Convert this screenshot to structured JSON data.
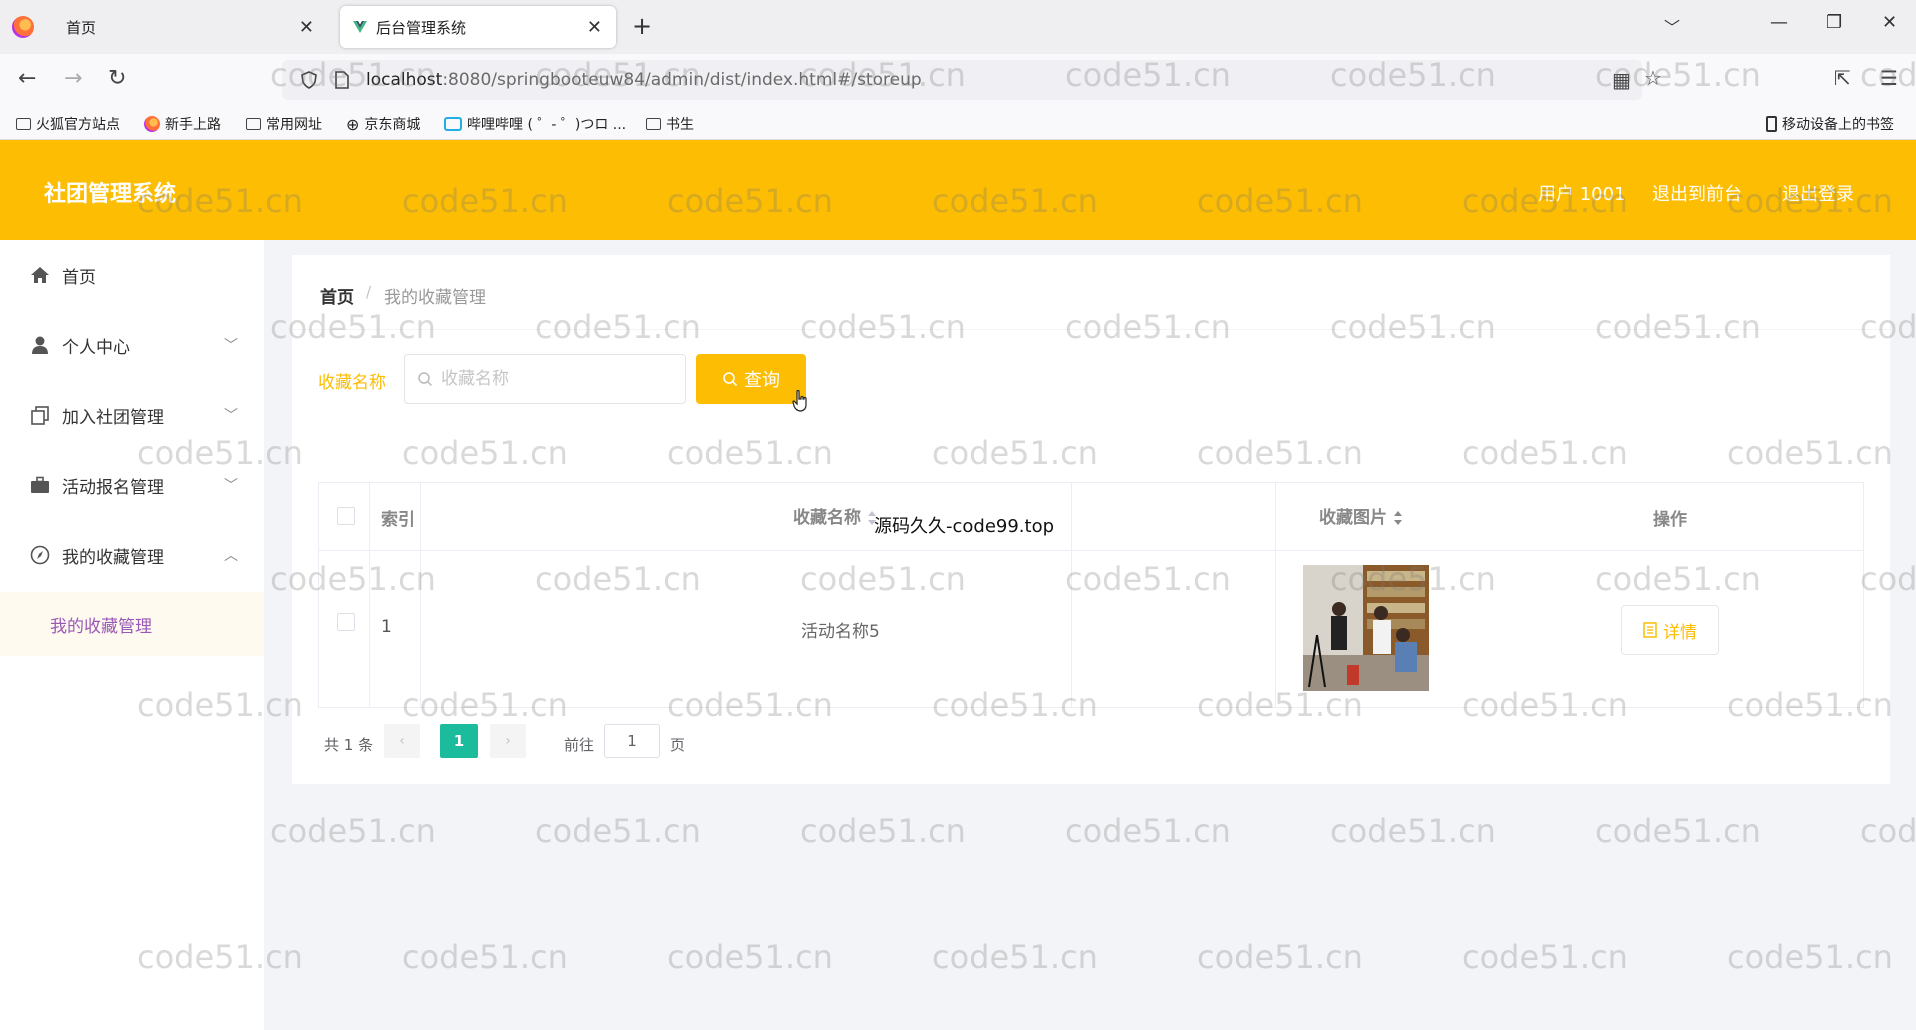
{
  "browser": {
    "tabs": [
      {
        "title": "首页"
      },
      {
        "title": "后台管理系统"
      }
    ],
    "url": {
      "host": "localhost",
      "rest": ":8080/springbooteuw84/admin/dist/index.html#/storeup"
    },
    "bookmarks": [
      {
        "label": "火狐官方站点",
        "icon": "folder-icon"
      },
      {
        "label": "新手上路",
        "icon": "firefox-icon"
      },
      {
        "label": "常用网址",
        "icon": "folder-icon"
      },
      {
        "label": "京东商城",
        "icon": "globe-icon"
      },
      {
        "label": "哔哩哔哩 ( ゜- ゜)つロ ...",
        "icon": "bilibili-icon"
      },
      {
        "label": "书生",
        "icon": "folder-icon"
      }
    ],
    "mobile_bookmarks": "移动设备上的书签"
  },
  "header": {
    "title": "社团管理系统",
    "user": "用户 1001",
    "to_front": "退出到前台",
    "logout": "退出登录"
  },
  "sidebar": {
    "items": [
      {
        "label": "首页",
        "icon": "home-icon"
      },
      {
        "label": "个人中心",
        "icon": "user-icon"
      },
      {
        "label": "加入社团管理",
        "icon": "copy-icon"
      },
      {
        "label": "活动报名管理",
        "icon": "briefcase-icon"
      },
      {
        "label": "我的收藏管理",
        "icon": "compass-icon"
      }
    ],
    "active_sub": "我的收藏管理"
  },
  "breadcrumb": {
    "home": "首页",
    "current": "我的收藏管理"
  },
  "search": {
    "label": "收藏名称",
    "placeholder": "收藏名称",
    "button": "查询"
  },
  "table": {
    "headers": {
      "index": "索引",
      "name": "收藏名称",
      "image": "收藏图片",
      "actions": "操作"
    },
    "rows": [
      {
        "index": "1",
        "name": "活动名称5",
        "action": "详情"
      }
    ]
  },
  "pagination": {
    "total": "共 1 条",
    "current": "1",
    "goto": "前往",
    "goto_value": "1",
    "page_unit": "页"
  },
  "overlay": "源码久久-code99.top",
  "watermark": "code51.cn",
  "colors": {
    "accent": "#fcbd02",
    "pager_active": "#1abc9c",
    "submenu_active": "#9b59b6"
  }
}
